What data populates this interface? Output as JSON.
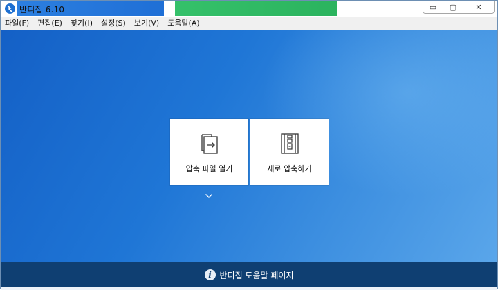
{
  "window": {
    "title": "반디집 6.10",
    "controls": {
      "minimize": "▭",
      "maximize": "▢",
      "close": "✕"
    }
  },
  "menu": [
    {
      "label": "파일(F)"
    },
    {
      "label": "편집(E)"
    },
    {
      "label": "찾기(I)"
    },
    {
      "label": "설정(S)"
    },
    {
      "label": "보기(V)"
    },
    {
      "label": "도움말(A)"
    }
  ],
  "actions": {
    "open": {
      "label": "압축 파일 열기",
      "icon": "open-archive-icon"
    },
    "new": {
      "label": "새로 압축하기",
      "icon": "zip-file-icon"
    }
  },
  "footer": {
    "text": "반디집 도움말 페이지",
    "icon": "info-icon"
  },
  "colors": {
    "main_blue": "#1f76d6",
    "footer": "#0f3f72"
  }
}
